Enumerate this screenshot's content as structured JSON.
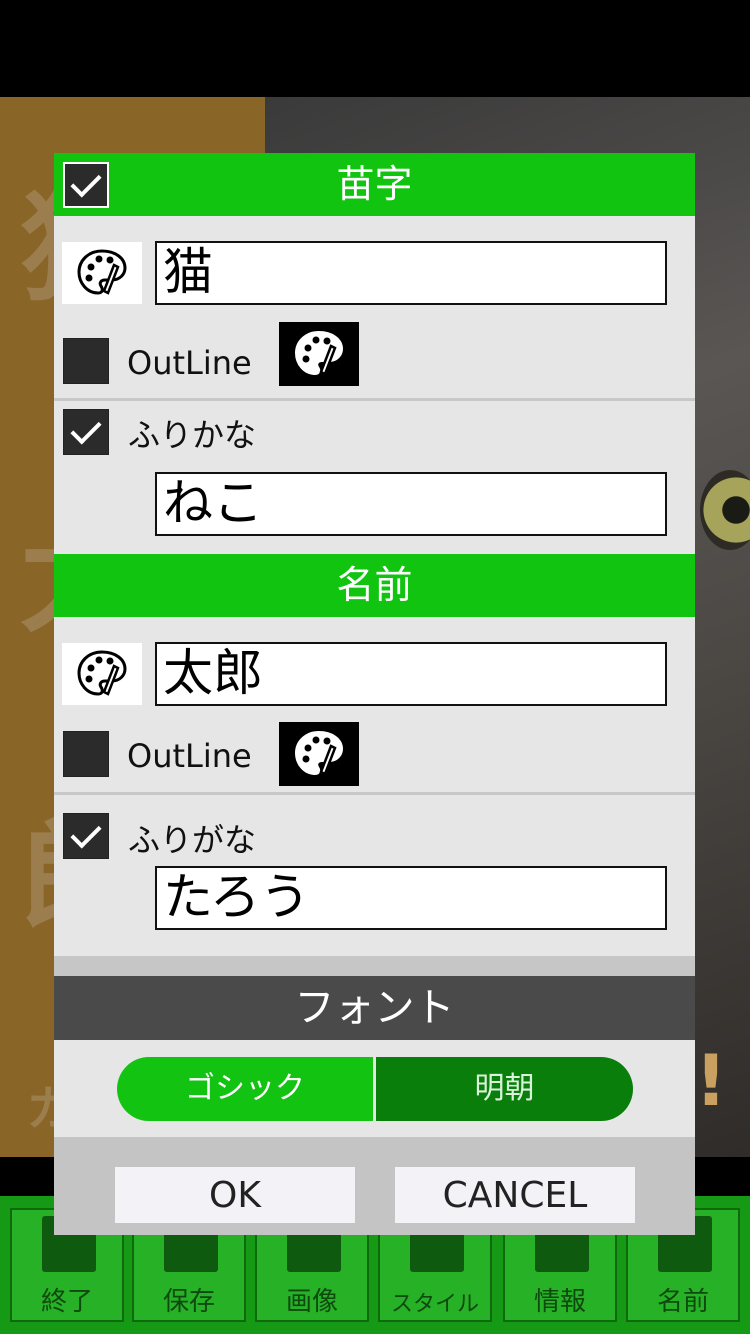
{
  "background": {
    "deco_chars": [
      "猫",
      "太",
      "郎"
    ],
    "deco_small": "カ",
    "exclaim": "!"
  },
  "dialog": {
    "surname": {
      "header": "苗字",
      "enabled": true,
      "value": "猫",
      "outline_label": "OutLine",
      "outline_checked": false,
      "furigana_label": "ふりかな",
      "furigana_checked": true,
      "furigana_value": "ねこ"
    },
    "given_name": {
      "header": "名前",
      "value": "太郎",
      "outline_label": "OutLine",
      "outline_checked": false,
      "furigana_label": "ふりがな",
      "furigana_checked": true,
      "furigana_value": "たろう"
    },
    "font": {
      "header": "フォント",
      "options": [
        "ゴシック",
        "明朝"
      ],
      "selected": "ゴシック"
    },
    "buttons": {
      "ok": "OK",
      "cancel": "CANCEL"
    }
  },
  "toolbar": {
    "items": [
      {
        "label": "終了",
        "icon": "exit-icon"
      },
      {
        "label": "保存",
        "icon": "save-icon"
      },
      {
        "label": "画像",
        "icon": "image-icon"
      },
      {
        "label": "スタイル",
        "icon": "style-icon"
      },
      {
        "label": "情報",
        "icon": "tag-icon"
      },
      {
        "label": "名前",
        "icon": "name-card-icon"
      }
    ]
  },
  "colors": {
    "header_green": "#10c410",
    "selected_segment": "#12c312",
    "unselected_segment": "#0a7e0a",
    "font_header": "#4a4a4a",
    "toolbar_green": "#169a16"
  }
}
